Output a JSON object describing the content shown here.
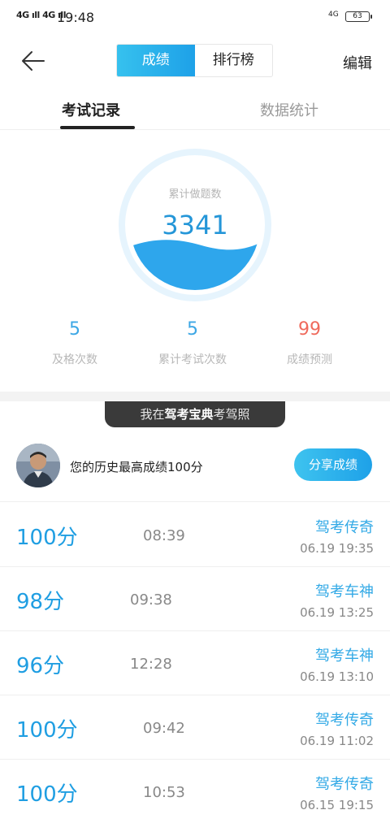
{
  "status_bar": {
    "signal": "4G ıll 4G ıll",
    "time": "19:48",
    "network": "4G",
    "battery": "63"
  },
  "header": {
    "tabs": [
      {
        "label": "成绩",
        "active": true
      },
      {
        "label": "排行榜",
        "active": false
      }
    ],
    "edit_label": "编辑",
    "back_icon": "back-arrow-icon"
  },
  "subtabs": {
    "items": [
      {
        "label": "考试记录",
        "active": true
      },
      {
        "label": "数据统计",
        "active": false
      }
    ]
  },
  "summary": {
    "circle_label": "累计做题数",
    "circle_value": "3341",
    "stats": [
      {
        "value": "5",
        "label": "及格次数"
      },
      {
        "value": "5",
        "label": "累计考试次数"
      },
      {
        "value": "99",
        "label": "成绩预测"
      }
    ]
  },
  "banner": {
    "prefix": "我在",
    "brand": "驾考宝典",
    "suffix": "考驾照"
  },
  "best": {
    "text": "您的历史最高成绩100分",
    "share_label": "分享成绩"
  },
  "records": [
    {
      "score": "100分",
      "duration": "08:39",
      "title": "驾考传奇",
      "date": "06.19  19:35"
    },
    {
      "score": "98分",
      "duration": "09:38",
      "title": "驾考车神",
      "date": "06.19  13:25"
    },
    {
      "score": "96分",
      "duration": "12:28",
      "title": "驾考车神",
      "date": "06.19  13:10"
    },
    {
      "score": "100分",
      "duration": "09:42",
      "title": "驾考传奇",
      "date": "06.19  11:02"
    },
    {
      "score": "100分",
      "duration": "10:53",
      "title": "驾考传奇",
      "date": "06.15  19:15"
    }
  ],
  "colors": {
    "accent": "#1ea1e8",
    "accent_light": "#36c1ee",
    "prediction_red": "#ef6a5c"
  }
}
